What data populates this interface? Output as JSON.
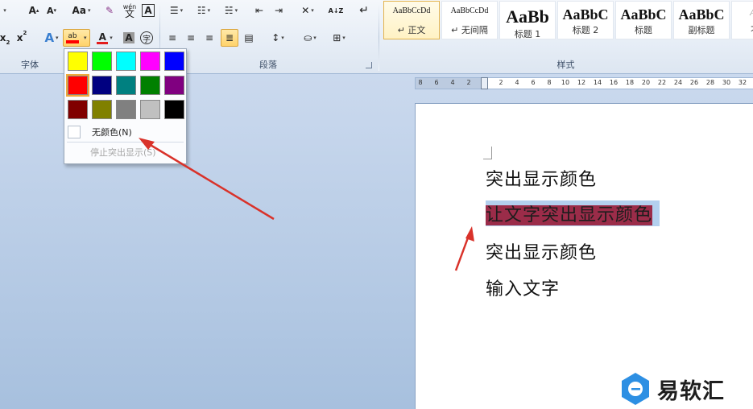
{
  "ribbon": {
    "font_group": {
      "label": "字体",
      "grow_font": "A",
      "shrink_font": "A",
      "change_case": "Aa",
      "phonetic": "wén",
      "char_border": "A",
      "subscript": "x",
      "superscript": "x",
      "text_effect": "A",
      "highlight": "ab",
      "font_color": "A",
      "char_shading": "A",
      "enclose": "字"
    },
    "paragraph_group": {
      "label": "段落",
      "sort": "A↓Z"
    },
    "styles_group": {
      "label": "样式",
      "items": [
        {
          "preview": "AaBbCcDd",
          "name": "↵ 正文",
          "selected": true
        },
        {
          "preview": "AaBbCcDd",
          "name": "↵ 无间隔",
          "selected": false
        },
        {
          "preview": "AaBb",
          "name": "标题 1",
          "selected": false
        },
        {
          "preview": "AaBbC",
          "name": "标题 2",
          "selected": false
        },
        {
          "preview": "AaBbC",
          "name": "标题",
          "selected": false
        },
        {
          "preview": "AaBbC",
          "name": "副标题",
          "selected": false
        },
        {
          "preview": "AaBl",
          "name": "不明",
          "selected": false
        }
      ]
    }
  },
  "highlight_menu": {
    "swatches": [
      [
        "#ffff00",
        "#00ff00",
        "#00ffff",
        "#ff00ff",
        "#0000ff"
      ],
      [
        "#ff0000",
        "#000080",
        "#008080",
        "#008000",
        "#800080"
      ],
      [
        "#800000",
        "#808000",
        "#808080",
        "#c0c0c0",
        "#000000"
      ]
    ],
    "selected_swatch": "#ff0000",
    "no_color": "无颜色(N)",
    "stop_highlight": "停止突出显示(S)"
  },
  "ruler": {
    "numbers": [
      "8",
      "6",
      "4",
      "2",
      "",
      "2",
      "4",
      "6",
      "8",
      "10",
      "12",
      "14",
      "16",
      "18",
      "20",
      "22",
      "24",
      "26",
      "28",
      "30",
      "32"
    ]
  },
  "document": {
    "lines": [
      {
        "text": "突出显示颜色",
        "highlighted": false
      },
      {
        "text": "让文字突出显示颜色",
        "highlighted": true,
        "highlight_color": "#9b2c49"
      },
      {
        "text": "突出显示颜色",
        "highlighted": false
      },
      {
        "text": "输入文字",
        "highlighted": false
      }
    ]
  },
  "watermark": {
    "text": "易软汇",
    "brand_color": "#2d8fe3"
  },
  "colors": {
    "annotation_arrow": "#d9322a",
    "selection": "#b3d0ee"
  }
}
